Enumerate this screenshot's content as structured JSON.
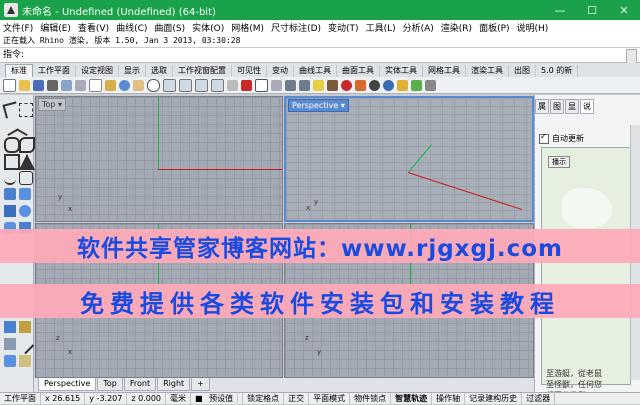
{
  "window": {
    "title": "未命名 - Undefined (Undefined) (64-bit)",
    "minimize_glyph": "—",
    "maximize_glyph": "☐",
    "close_glyph": "✕"
  },
  "menu": [
    "文件(F)",
    "编辑(E)",
    "查看(V)",
    "曲线(C)",
    "曲面(S)",
    "实体(O)",
    "网格(M)",
    "尺寸标注(D)",
    "变动(T)",
    "工具(L)",
    "分析(A)",
    "渲染(R)",
    "面板(P)",
    "说明(H)"
  ],
  "history_text": "正在载入 Rhino 渲染, 版本 1.50, Jan  3 2013, 03:30:28",
  "command": {
    "label": "指令:"
  },
  "tool_tabs": [
    "标准",
    "工作平面",
    "设定视图",
    "显示",
    "选取",
    "工作视窗配置",
    "可见性",
    "变动",
    "曲线工具",
    "曲面工具",
    "实体工具",
    "网格工具",
    "渲染工具",
    "出图",
    "5.0 的新"
  ],
  "viewports": {
    "top": "Top",
    "perspective": "Perspective",
    "front": "Front",
    "right": "Right",
    "axis_x": "x",
    "axis_y": "y",
    "axis_z": "z"
  },
  "viewport_tabs": [
    "Perspective",
    "Top",
    "Front",
    "Right",
    "+"
  ],
  "panel": {
    "tabs": [
      "属",
      "图",
      "",
      "显",
      "说"
    ],
    "auto_update": "自动更新",
    "button": "播示",
    "help_text": "至游艇，從老鼠\n至怪獸，任何您\n想要的造型。"
  },
  "status": {
    "workplane": "工作平面",
    "x": "x 26.615",
    "y": "y -3.207",
    "z": "z 0.000",
    "units": "毫米",
    "layer": "预设值",
    "toggles": [
      "锁定格点",
      "正交",
      "平面模式",
      "物件锁点",
      "智慧轨迹",
      "操作轴",
      "记录建构历史",
      "过滤器"
    ]
  },
  "watermark": {
    "line1": "软件共享管家博客网站：www.rjgxgj.com",
    "line2": "免费提供各类软件安装包和安装教程"
  },
  "colors": {
    "titlebar": "#1aa24a",
    "axis_x": "#c81e1e",
    "axis_y": "#1bb24a",
    "banner_text": "#1a4be0",
    "banner_bg": "#ffaab9"
  }
}
